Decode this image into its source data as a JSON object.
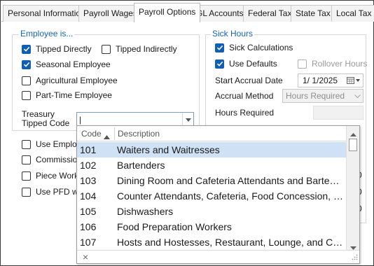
{
  "tabs": [
    {
      "label": "Personal Information"
    },
    {
      "label": "Payroll Wages"
    },
    {
      "label": "Payroll Options"
    },
    {
      "label": "GL Accounts"
    },
    {
      "label": "Federal Tax"
    },
    {
      "label": "State Tax"
    },
    {
      "label": "Local Tax"
    }
  ],
  "employee": {
    "title": "Employee is...",
    "tipped_directly": "Tipped Directly",
    "tipped_indirectly": "Tipped Indirectly",
    "seasonal": "Seasonal Employee",
    "agricultural": "Agricultural Employee",
    "part_time": "Part-Time Employee",
    "treasury_label_1": "Treasury",
    "treasury_label_2": "Tipped Code",
    "treasury_value": "|"
  },
  "lower_checks": {
    "use_employee": "Use Employe",
    "commissions": "Commissions",
    "piece_work": "Piece Work",
    "use_pfd": "Use PFD wit"
  },
  "sick": {
    "title": "Sick Hours",
    "sick_calculations": "Sick Calculations",
    "use_defaults": "Use Defaults",
    "rollover": "Rollover Hours",
    "start_accrual_label": "Start Accrual Date",
    "start_accrual_value": "1/  1/2025",
    "accrual_method_label": "Accrual Method",
    "accrual_method_value": "Hours Required",
    "hours_required_label": "Hours Required"
  },
  "dropdown": {
    "col_code": "Code",
    "col_desc": "Description",
    "rows": [
      {
        "code": "101",
        "desc": "Waiters and Waitresses"
      },
      {
        "code": "102",
        "desc": "Bartenders"
      },
      {
        "code": "103",
        "desc": "Dining Room and Cafeteria Attendants and Bartender Helpers"
      },
      {
        "code": "104",
        "desc": "Counter Attendants, Cafeteria, Food Concession, and Coffee Shop"
      },
      {
        "code": "105",
        "desc": "Dishwashers"
      },
      {
        "code": "106",
        "desc": "Food Preparation Workers"
      },
      {
        "code": "107",
        "desc": "Hosts and Hostesses, Restaurant, Lounge, and Coffee Shop"
      }
    ],
    "clear_glyph": "×"
  },
  "right_edge_values": [
    "0",
    "0",
    "0"
  ],
  "colors": {
    "accent": "#0f5fb6",
    "selected_row": "#cfe1f5",
    "group_title": "#1464b4"
  }
}
